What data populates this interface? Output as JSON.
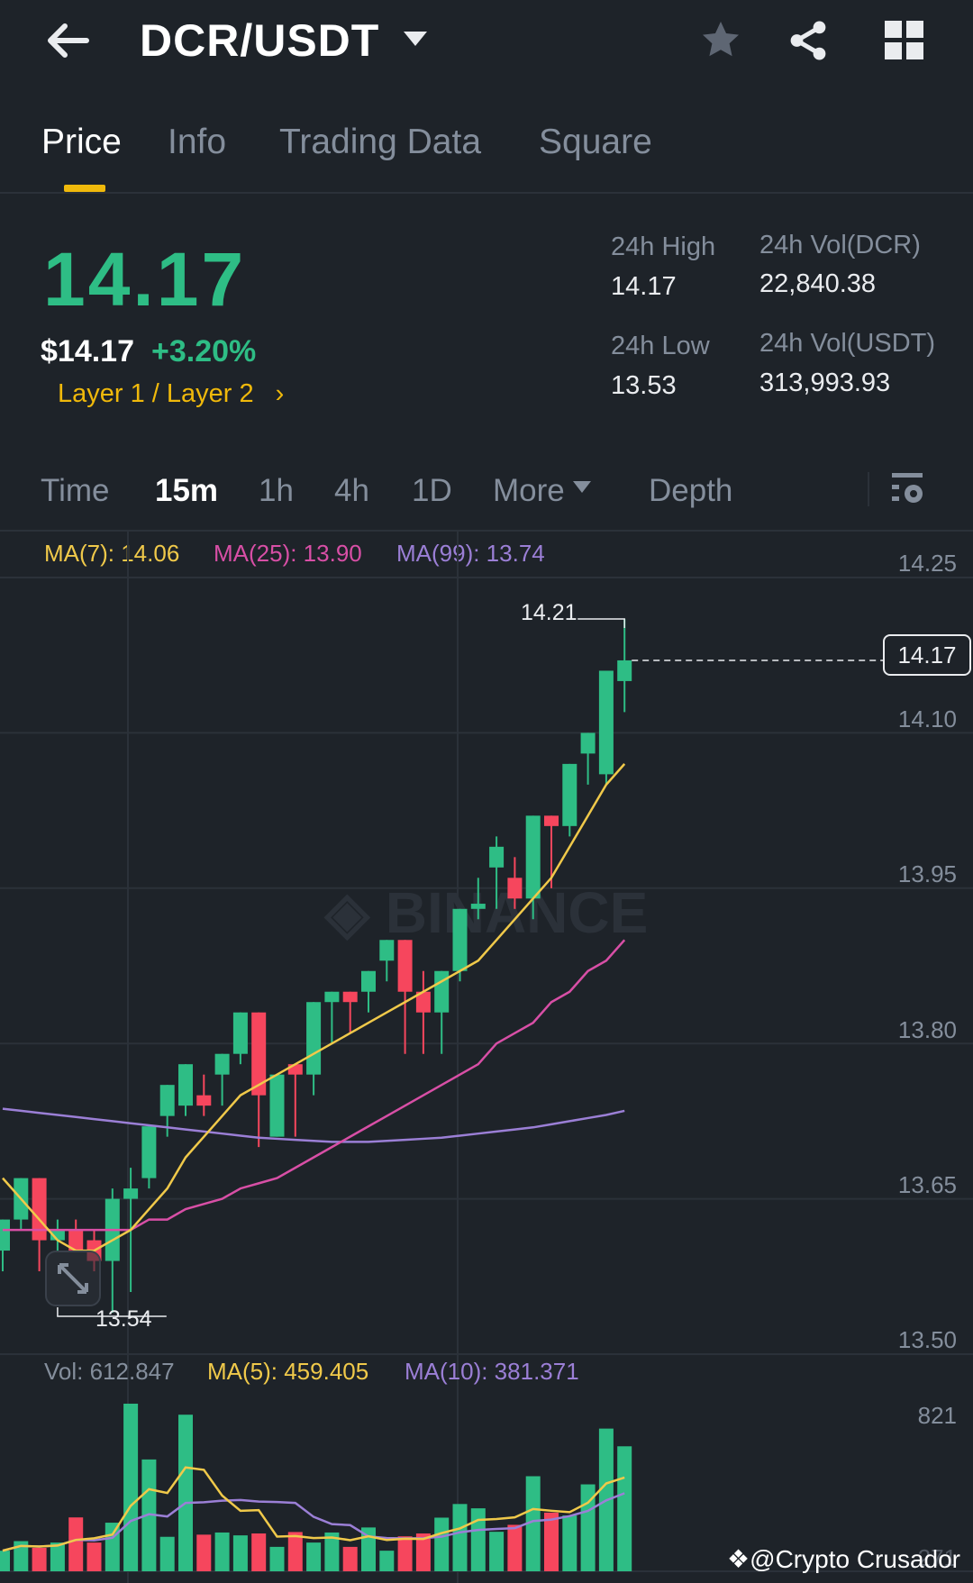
{
  "header": {
    "title": "DCR/USDT"
  },
  "tabs": [
    {
      "label": "Price"
    },
    {
      "label": "Info"
    },
    {
      "label": "Trading Data"
    },
    {
      "label": "Square"
    }
  ],
  "price": {
    "last": "14.17",
    "usd": "$14.17",
    "change": "+3.20%",
    "tags": "Layer 1 / Layer 2"
  },
  "stats": {
    "high_label": "24h High",
    "high": "14.17",
    "low_label": "24h Low",
    "low": "13.53",
    "vol_base_label": "24h Vol(DCR)",
    "vol_base": "22,840.38",
    "vol_quote_label": "24h Vol(USDT)",
    "vol_quote": "313,993.93"
  },
  "intervals": [
    {
      "label": "Time"
    },
    {
      "label": "15m"
    },
    {
      "label": "1h"
    },
    {
      "label": "4h"
    },
    {
      "label": "1D"
    },
    {
      "label": "More"
    },
    {
      "label": "Depth"
    }
  ],
  "ma_legend": {
    "ma7": "MA(7): 14.06",
    "ma25": "MA(25): 13.90",
    "ma99": "MA(99): 13.74"
  },
  "vol_legend": {
    "vol": "Vol: 612.847",
    "ma5": "MA(5): 459.405",
    "ma10": "MA(10): 381.371"
  },
  "price_axis": [
    "14.25",
    "14.10",
    "13.95",
    "13.80",
    "13.65",
    "13.50"
  ],
  "vol_axis": [
    "821",
    "271"
  ],
  "current_price_label": "14.17",
  "max_label": "14.21",
  "min_label": "13.54",
  "watermark": "@Crypto Crusador",
  "colors": {
    "up": "#2ebd85",
    "down": "#f6465d",
    "ma7": "#f0c94a",
    "ma25": "#d84fa6",
    "ma99": "#9b7fd6",
    "accent": "#f0b90b"
  },
  "chart_data": {
    "type": "candlestick",
    "interval": "15m",
    "ylim": [
      13.5,
      14.25
    ],
    "ohlc": [
      [
        13.6,
        13.63,
        13.58,
        13.63
      ],
      [
        13.63,
        13.67,
        13.62,
        13.67
      ],
      [
        13.67,
        13.67,
        13.58,
        13.61
      ],
      [
        13.61,
        13.63,
        13.6,
        13.62
      ],
      [
        13.62,
        13.63,
        13.6,
        13.6
      ],
      [
        13.61,
        13.62,
        13.58,
        13.59
      ],
      [
        13.59,
        13.66,
        13.54,
        13.65
      ],
      [
        13.65,
        13.68,
        13.56,
        13.66
      ],
      [
        13.67,
        13.72,
        13.66,
        13.72
      ],
      [
        13.73,
        13.76,
        13.71,
        13.76
      ],
      [
        13.74,
        13.78,
        13.73,
        13.78
      ],
      [
        13.75,
        13.77,
        13.73,
        13.74
      ],
      [
        13.77,
        13.79,
        13.74,
        13.79
      ],
      [
        13.79,
        13.83,
        13.78,
        13.83
      ],
      [
        13.83,
        13.83,
        13.7,
        13.75
      ],
      [
        13.71,
        13.77,
        13.71,
        13.77
      ],
      [
        13.78,
        13.78,
        13.71,
        13.77
      ],
      [
        13.77,
        13.84,
        13.75,
        13.84
      ],
      [
        13.84,
        13.85,
        13.8,
        13.85
      ],
      [
        13.85,
        13.85,
        13.81,
        13.84
      ],
      [
        13.85,
        13.87,
        13.83,
        13.87
      ],
      [
        13.88,
        13.9,
        13.86,
        13.9
      ],
      [
        13.9,
        13.9,
        13.79,
        13.85
      ],
      [
        13.85,
        13.87,
        13.79,
        13.83
      ],
      [
        13.83,
        13.87,
        13.79,
        13.87
      ],
      [
        13.87,
        13.93,
        13.86,
        13.93
      ],
      [
        13.93,
        13.96,
        13.92,
        13.935
      ],
      [
        13.97,
        14.0,
        13.93,
        13.99
      ],
      [
        13.96,
        13.98,
        13.93,
        13.94
      ],
      [
        13.94,
        14.02,
        13.92,
        14.02
      ],
      [
        14.02,
        14.02,
        13.95,
        14.01
      ],
      [
        14.01,
        14.07,
        14.0,
        14.07
      ],
      [
        14.08,
        14.1,
        14.05,
        14.1
      ],
      [
        14.06,
        14.16,
        14.05,
        14.16
      ],
      [
        14.15,
        14.21,
        14.12,
        14.17
      ]
    ],
    "ma7": [
      13.67,
      13.65,
      13.63,
      13.61,
      13.6,
      13.6,
      13.61,
      13.62,
      13.64,
      13.66,
      13.69,
      13.71,
      13.73,
      13.75,
      13.76,
      13.77,
      13.78,
      13.79,
      13.8,
      13.81,
      13.82,
      13.83,
      13.84,
      13.85,
      13.86,
      13.87,
      13.88,
      13.9,
      13.92,
      13.94,
      13.96,
      13.99,
      14.02,
      14.05,
      14.07
    ],
    "ma25": [
      13.62,
      13.62,
      13.62,
      13.62,
      13.62,
      13.62,
      13.62,
      13.62,
      13.63,
      13.63,
      13.64,
      13.645,
      13.65,
      13.66,
      13.665,
      13.67,
      13.68,
      13.69,
      13.7,
      13.71,
      13.72,
      13.73,
      13.74,
      13.75,
      13.76,
      13.77,
      13.78,
      13.8,
      13.81,
      13.82,
      13.84,
      13.85,
      13.87,
      13.88,
      13.9
    ],
    "ma99": [
      13.737,
      13.735,
      13.733,
      13.731,
      13.729,
      13.727,
      13.725,
      13.723,
      13.721,
      13.719,
      13.717,
      13.715,
      13.713,
      13.711,
      13.709,
      13.708,
      13.707,
      13.706,
      13.705,
      13.705,
      13.705,
      13.706,
      13.707,
      13.708,
      13.709,
      13.711,
      13.713,
      13.715,
      13.717,
      13.719,
      13.722,
      13.725,
      13.728,
      13.731,
      13.735
    ],
    "volume_ylim": [
      193,
      923
    ],
    "volume": [
      279,
      319,
      291,
      313,
      418,
      313,
      396,
      893,
      660,
      337,
      847,
      346,
      355,
      343,
      351,
      295,
      357,
      313,
      355,
      295,
      376,
      279,
      339,
      351,
      417,
      474,
      456,
      358,
      387,
      590,
      438,
      426,
      556,
      789,
      715
    ]
  }
}
